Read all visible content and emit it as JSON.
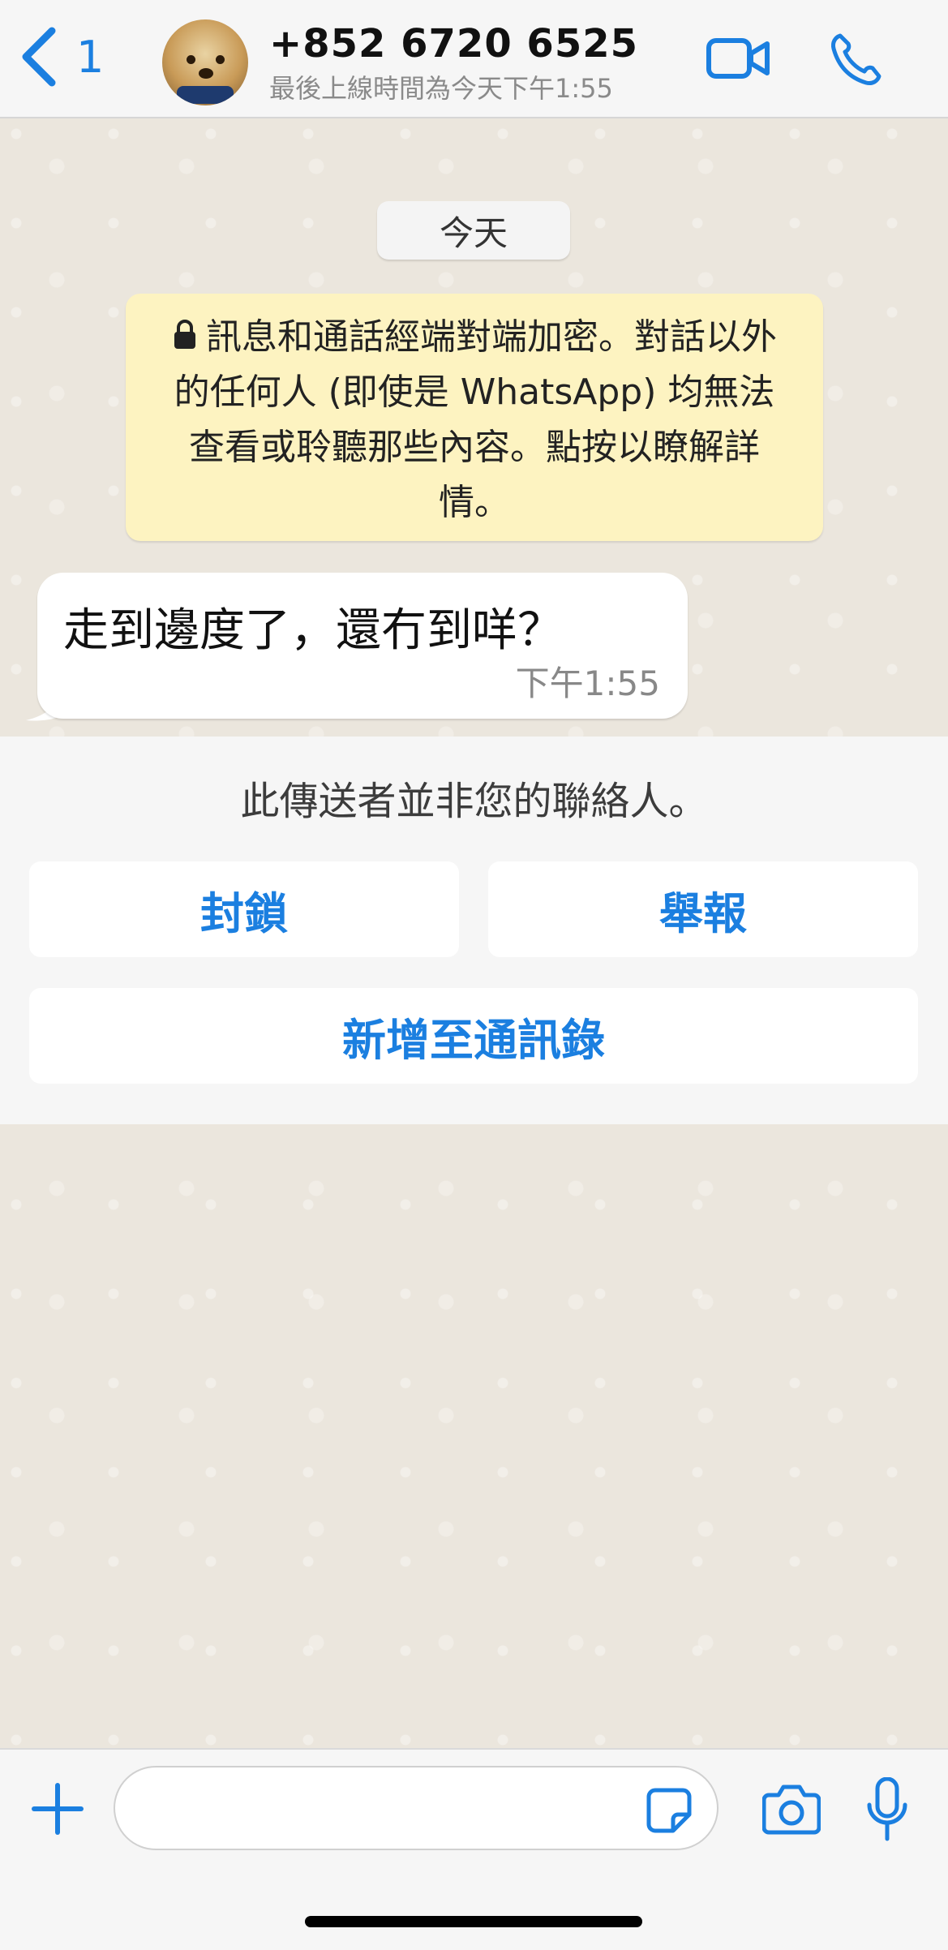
{
  "header": {
    "back_count": "1",
    "contact_name": "+852 6720 6525",
    "last_seen": "最後上線時間為今天下午1:55",
    "icons": [
      "back-chevron-icon",
      "video-call-icon",
      "phone-call-icon"
    ]
  },
  "chat": {
    "date_chip": "今天",
    "encryption_notice": "訊息和通話經端對端加密。對話以外的任何人 (即使是 WhatsApp) 均無法查看或聆聽那些內容。點按以瞭解詳情。",
    "messages": [
      {
        "text": "走到邊度了，還冇到咩？",
        "time": "下午1:55",
        "direction": "incoming"
      }
    ]
  },
  "non_contact_panel": {
    "note": "此傳送者並非您的聯絡人。",
    "block_label": "封鎖",
    "report_label": "舉報",
    "add_contact_label": "新增至通訊錄"
  },
  "input_bar": {
    "message_value": "",
    "icons": [
      "plus-icon",
      "sticker-icon",
      "camera-icon",
      "microphone-icon"
    ]
  },
  "colors": {
    "accent": "#1b7fe0",
    "chat_background": "#efeae2",
    "notice_background": "#fdf3c1",
    "bar_background": "#f6f6f6"
  }
}
